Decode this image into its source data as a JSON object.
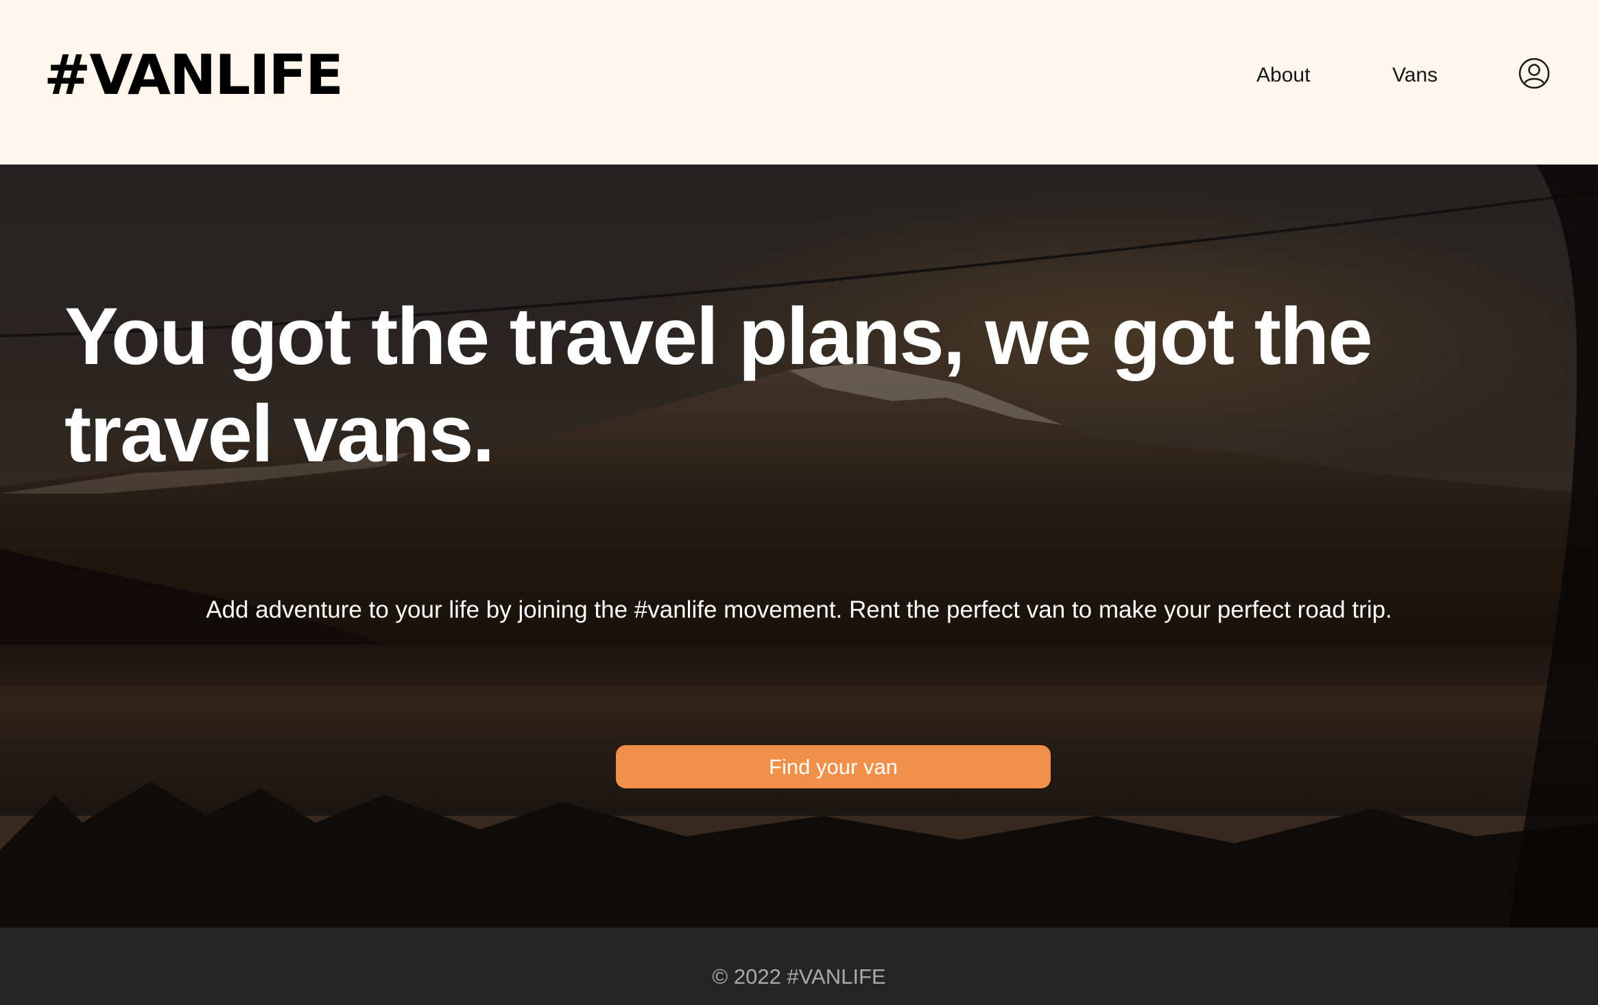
{
  "header": {
    "logo": "#VANLIFE",
    "nav": {
      "about": "About",
      "vans": "Vans"
    },
    "user_icon": "user-circle-icon"
  },
  "hero": {
    "title": "You got the travel plans, we got the travel vans.",
    "subtitle": "Add adventure to your life by joining the #vanlife movement. Rent the perfect van to make your perfect road trip.",
    "cta_label": "Find your van",
    "background_image": "mountain-lake-landscape"
  },
  "footer": {
    "copyright": "© 2022 #VANLIFE"
  },
  "colors": {
    "header_bg": "#FFF7ED",
    "cta_bg": "#F0904A",
    "footer_bg": "#252525",
    "footer_text": "#AAAAAA"
  }
}
